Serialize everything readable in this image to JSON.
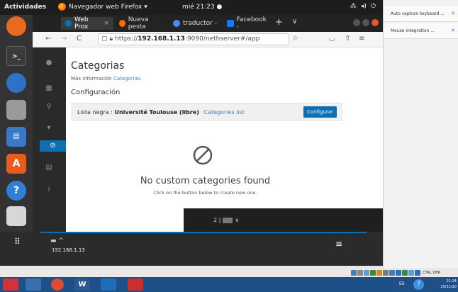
{
  "topbar": {
    "activities": "Actividades",
    "app_name": "Navegador web Firefox ▾",
    "clock": "mié 21:23 ●",
    "tray_icons": [
      "network-icon",
      "volume-icon",
      "power-icon"
    ]
  },
  "browser": {
    "tabs": [
      {
        "label": "Web Prox",
        "close": "×",
        "active": true,
        "icon_color": "#0e6fb3"
      },
      {
        "label": "Nueva pesta",
        "active": false,
        "icon_color": "#ff6a00"
      },
      {
        "label": "traductor -",
        "active": false,
        "icon_color": "#4a8af4"
      },
      {
        "label": "Facebook -",
        "active": false,
        "icon_color": "#1877f2"
      }
    ],
    "new_tab": "+",
    "tab_list": "∨",
    "nav": {
      "back": "←",
      "forward": "→",
      "reload": "C"
    },
    "url_prefix": "https://",
    "url_host": "192.168.1.13",
    "url_rest": ":9090/nethserver#/app"
  },
  "page": {
    "title": "Categorias",
    "more_info_text": "Más información",
    "more_info_link": "Categorias.",
    "config_heading": "Configuración",
    "list_label": "Lista negra :",
    "list_name": "Université Toulouse (libre)",
    "categories_link": "Categories list",
    "configure_button": "Configurar",
    "empty_title": "No custom categories found",
    "empty_sub": "Click on the button below to create new one.",
    "user_icon": "2 |",
    "user_caret": "∨"
  },
  "vm_bottom": {
    "ip": "192.168.1.13",
    "monitor_caret": "^",
    "menu": "≡"
  },
  "notifications": [
    {
      "text": "Auto capture keyboard ...",
      "close": "✕"
    },
    {
      "text": "Mouse integration ...",
      "close": "✕"
    }
  ],
  "host_tray": {
    "text": "CTRL DER",
    "lang": "ES",
    "help": "?",
    "time": "21:24",
    "date": "29/11/20"
  },
  "taskbar_apps": [
    {
      "name": "start-icon",
      "color": "#d13438",
      "glyph": "◉"
    },
    {
      "name": "files-icon",
      "color": "#3a6fb0",
      "glyph": "▭"
    },
    {
      "name": "chrome-icon",
      "color": "#e04a2f",
      "glyph": "◎"
    },
    {
      "name": "word-icon",
      "color": "#2b5797",
      "glyph": "W"
    },
    {
      "name": "app5-icon",
      "color": "#1e6db8",
      "glyph": "✚"
    },
    {
      "name": "app6-icon",
      "color": "#c9302c",
      "glyph": "▣"
    }
  ],
  "dock_apps": [
    {
      "name": "firefox-dock-icon",
      "color": "#e86a1f",
      "glyph": "●"
    },
    {
      "name": "terminal-dock-icon",
      "color": "#3a3a3a",
      "glyph": ">_"
    },
    {
      "name": "thunderbird-dock-icon",
      "color": "#2e72c5",
      "glyph": "✉"
    },
    {
      "name": "files-dock-icon",
      "color": "#8a8a8a",
      "glyph": "▭"
    },
    {
      "name": "writer-dock-icon",
      "color": "#3c78c8",
      "glyph": "▤"
    },
    {
      "name": "software-dock-icon",
      "color": "#e85b1c",
      "glyph": "A"
    },
    {
      "name": "help-dock-icon",
      "color": "#2f7fd6",
      "glyph": "?"
    },
    {
      "name": "disk-dock-icon",
      "color": "#d7d7d7",
      "glyph": "◉"
    }
  ]
}
